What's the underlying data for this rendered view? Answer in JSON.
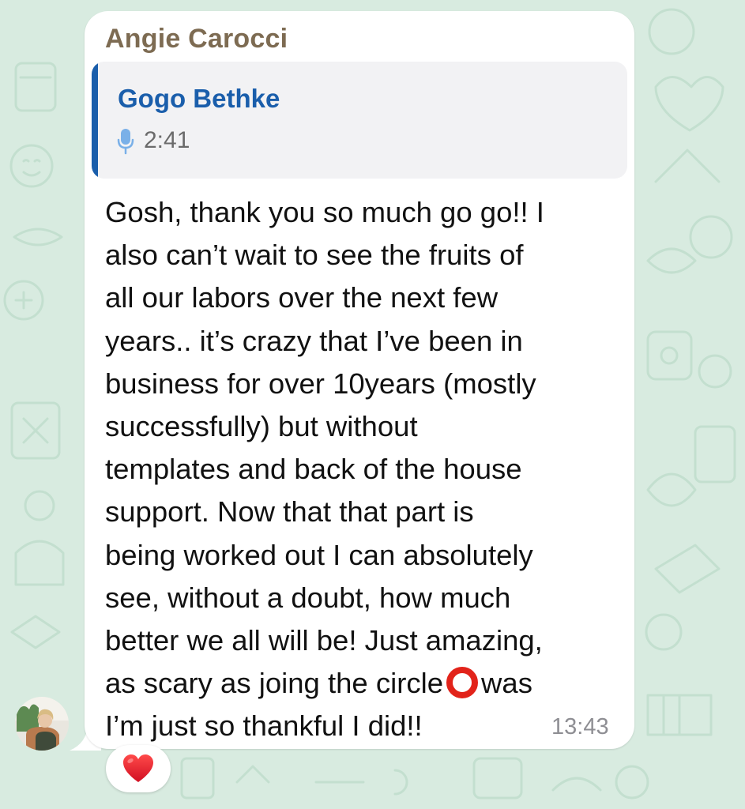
{
  "message": {
    "sender": "Angie Carocci",
    "quoted": {
      "author": "Gogo Bethke",
      "type_icon": "microphone-icon",
      "duration": "2:41"
    },
    "text_before_emoji": "Gosh, thank you so much go go!! I\nalso can’t wait to see the fruits of\nall our labors over the next few\nyears.. it’s crazy that I’ve been in\nbusiness for over 10years (mostly\nsuccessfully) but without\ntemplates and back of the house\nsupport. Now that that part is\nbeing worked out I can absolutely\nsee, without a doubt, how much\nbetter we all will be! Just amazing,\nas scary as joing the circle",
    "emoji": "hollow-red-circle",
    "text_after_emoji": "was\nI’m just so thankful I did!!",
    "time": "13:43",
    "reaction": "heart"
  },
  "colors": {
    "background": "#d8ebe0",
    "sender_name": "#7d6b52",
    "quote_accent": "#1a5eab",
    "bubble": "#ffffff",
    "heart": "#e0192b"
  }
}
